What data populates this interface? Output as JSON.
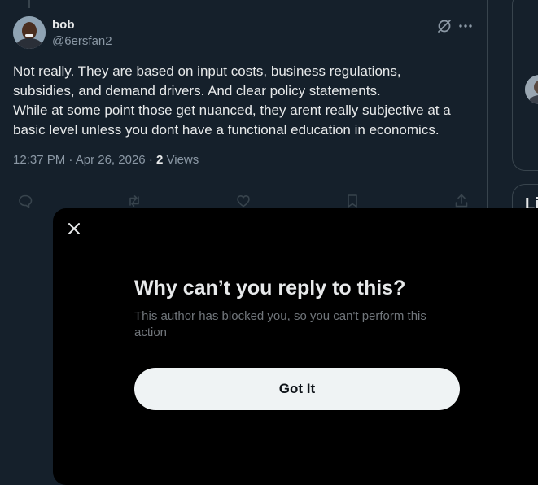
{
  "tweet": {
    "display_name": "bob",
    "handle": "@6ersfan2",
    "text_lines": [
      "Not really. They are based on input costs, business regulations,",
      "subsidies, and demand drivers. And clear policy statements.",
      "While at some point those get nuanced, they arent really subjective at a",
      "basic level unless you dont have a functional education in economics."
    ],
    "time": "12:37 PM",
    "date": "Apr 26, 2026",
    "separator": "·",
    "views_count": "2",
    "views_label": "Views"
  },
  "sidebar": {
    "card2_text": "Li"
  },
  "modal": {
    "title": "Why can’t you reply to this?",
    "description": "This author has blocked you, so you can't perform this action",
    "button_label": "Got It"
  },
  "colors": {
    "background": "#15202b",
    "modal_background": "#000000",
    "text_primary": "#e7e9ea",
    "text_secondary": "#8b98a5",
    "border": "#38444d",
    "button_background": "#eff3f4"
  },
  "icons": [
    "grok-icon",
    "more-icon",
    "reply-icon",
    "retweet-icon",
    "like-icon",
    "bookmark-icon",
    "share-icon",
    "close-icon"
  ]
}
